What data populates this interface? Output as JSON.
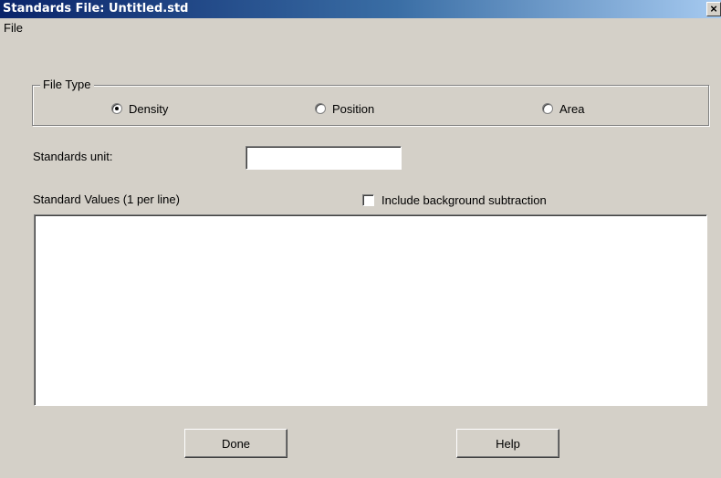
{
  "window": {
    "title": "Standards File: Untitled.std",
    "close_glyph": "×"
  },
  "menu": {
    "items": [
      {
        "label": "File"
      }
    ]
  },
  "file_type": {
    "group_label": "File Type",
    "options": [
      {
        "label": "Density",
        "selected": true
      },
      {
        "label": "Position",
        "selected": false
      },
      {
        "label": "Area",
        "selected": false
      }
    ]
  },
  "standards_unit": {
    "label": "Standards unit:",
    "value": ""
  },
  "standard_values": {
    "label": "Standard Values (1 per line)",
    "value": ""
  },
  "background_subtraction": {
    "label": "Include background subtraction",
    "checked": false
  },
  "buttons": {
    "done": "Done",
    "help": "Help"
  },
  "colors": {
    "dialog_face": "#d4d0c8",
    "titlebar_start": "#0a246a",
    "titlebar_end": "#a6caf0"
  }
}
